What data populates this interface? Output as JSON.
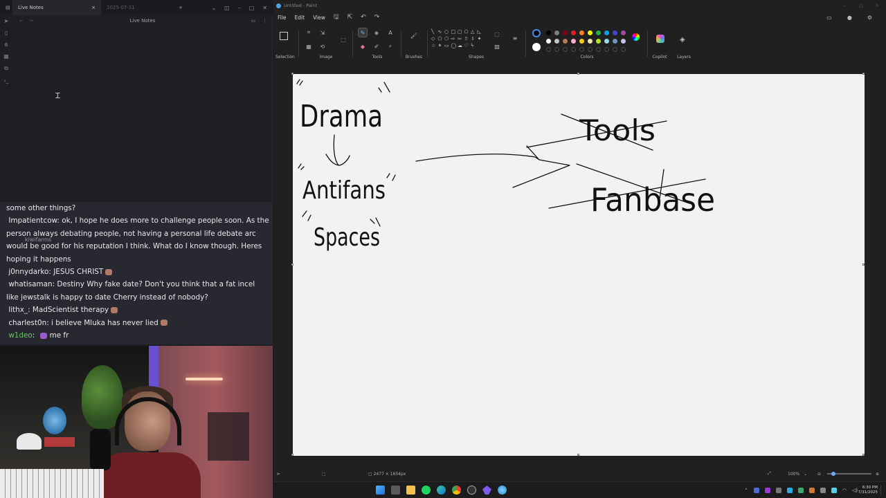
{
  "notes_app": {
    "tabs": [
      {
        "label": "Live Notes",
        "close": "×"
      },
      {
        "label": "2025-07-31"
      }
    ],
    "new_tab": "+",
    "header_title": "Live Notes"
  },
  "chat": {
    "partial_top": "some other things?",
    "ghost_text": "kiwifarms",
    "messages": [
      {
        "user": "Impatientcow",
        "text": "ok, I hope he does more to challenge people soon. As the person always debating people, not having a personal life debate arc would be good for his reputation I think. What do I know though. Heres hoping it happens"
      },
      {
        "user": "j0nnydarko",
        "text": "JESUS CHRIST",
        "emote": true
      },
      {
        "user": "whatisaman",
        "text": "Destiny Why fake date? Don't you think that a fat incel like jewstalk is happy to date Cherry instead of nobody?"
      },
      {
        "user": "lithx_",
        "text": "MadScientist therapy",
        "emote": true
      },
      {
        "user": "charlest0n",
        "text": "i believe Mluka has never lied",
        "emote": true
      },
      {
        "user": "w1deo",
        "text": "me fr",
        "green": true,
        "badge": true
      }
    ]
  },
  "paint": {
    "window_title": "Untitled - Paint",
    "menu": {
      "file": "File",
      "edit": "Edit",
      "view": "View"
    },
    "groups": {
      "selection": "Selection",
      "image": "Image",
      "tools": "Tools",
      "brushes": "Brushes",
      "shapes": "Shapes",
      "colors": "Colors",
      "copilot": "Copilot",
      "layers": "Layers"
    },
    "palette": [
      "#000000",
      "#7f7f7f",
      "#880015",
      "#ed1c24",
      "#ff7f27",
      "#fff200",
      "#22b14c",
      "#00a2e8",
      "#3f48cc",
      "#a349a4",
      "#ffffff",
      "#c3c3c3",
      "#b97a57",
      "#ffaec9",
      "#ffc90e",
      "#efe4b0",
      "#b5e61d",
      "#99d9ea",
      "#7092be",
      "#c8bfe7"
    ],
    "canvas_text": {
      "word1": "Drama",
      "word2": "Tools",
      "word3": "Antifans",
      "word4": "Fanbase",
      "word5": "Spaces"
    },
    "status": {
      "dimensions": "2477 × 1654px",
      "zoom": "100%"
    }
  },
  "taskbar": {
    "time": "6:30 PM",
    "date": "7/31/2025"
  }
}
